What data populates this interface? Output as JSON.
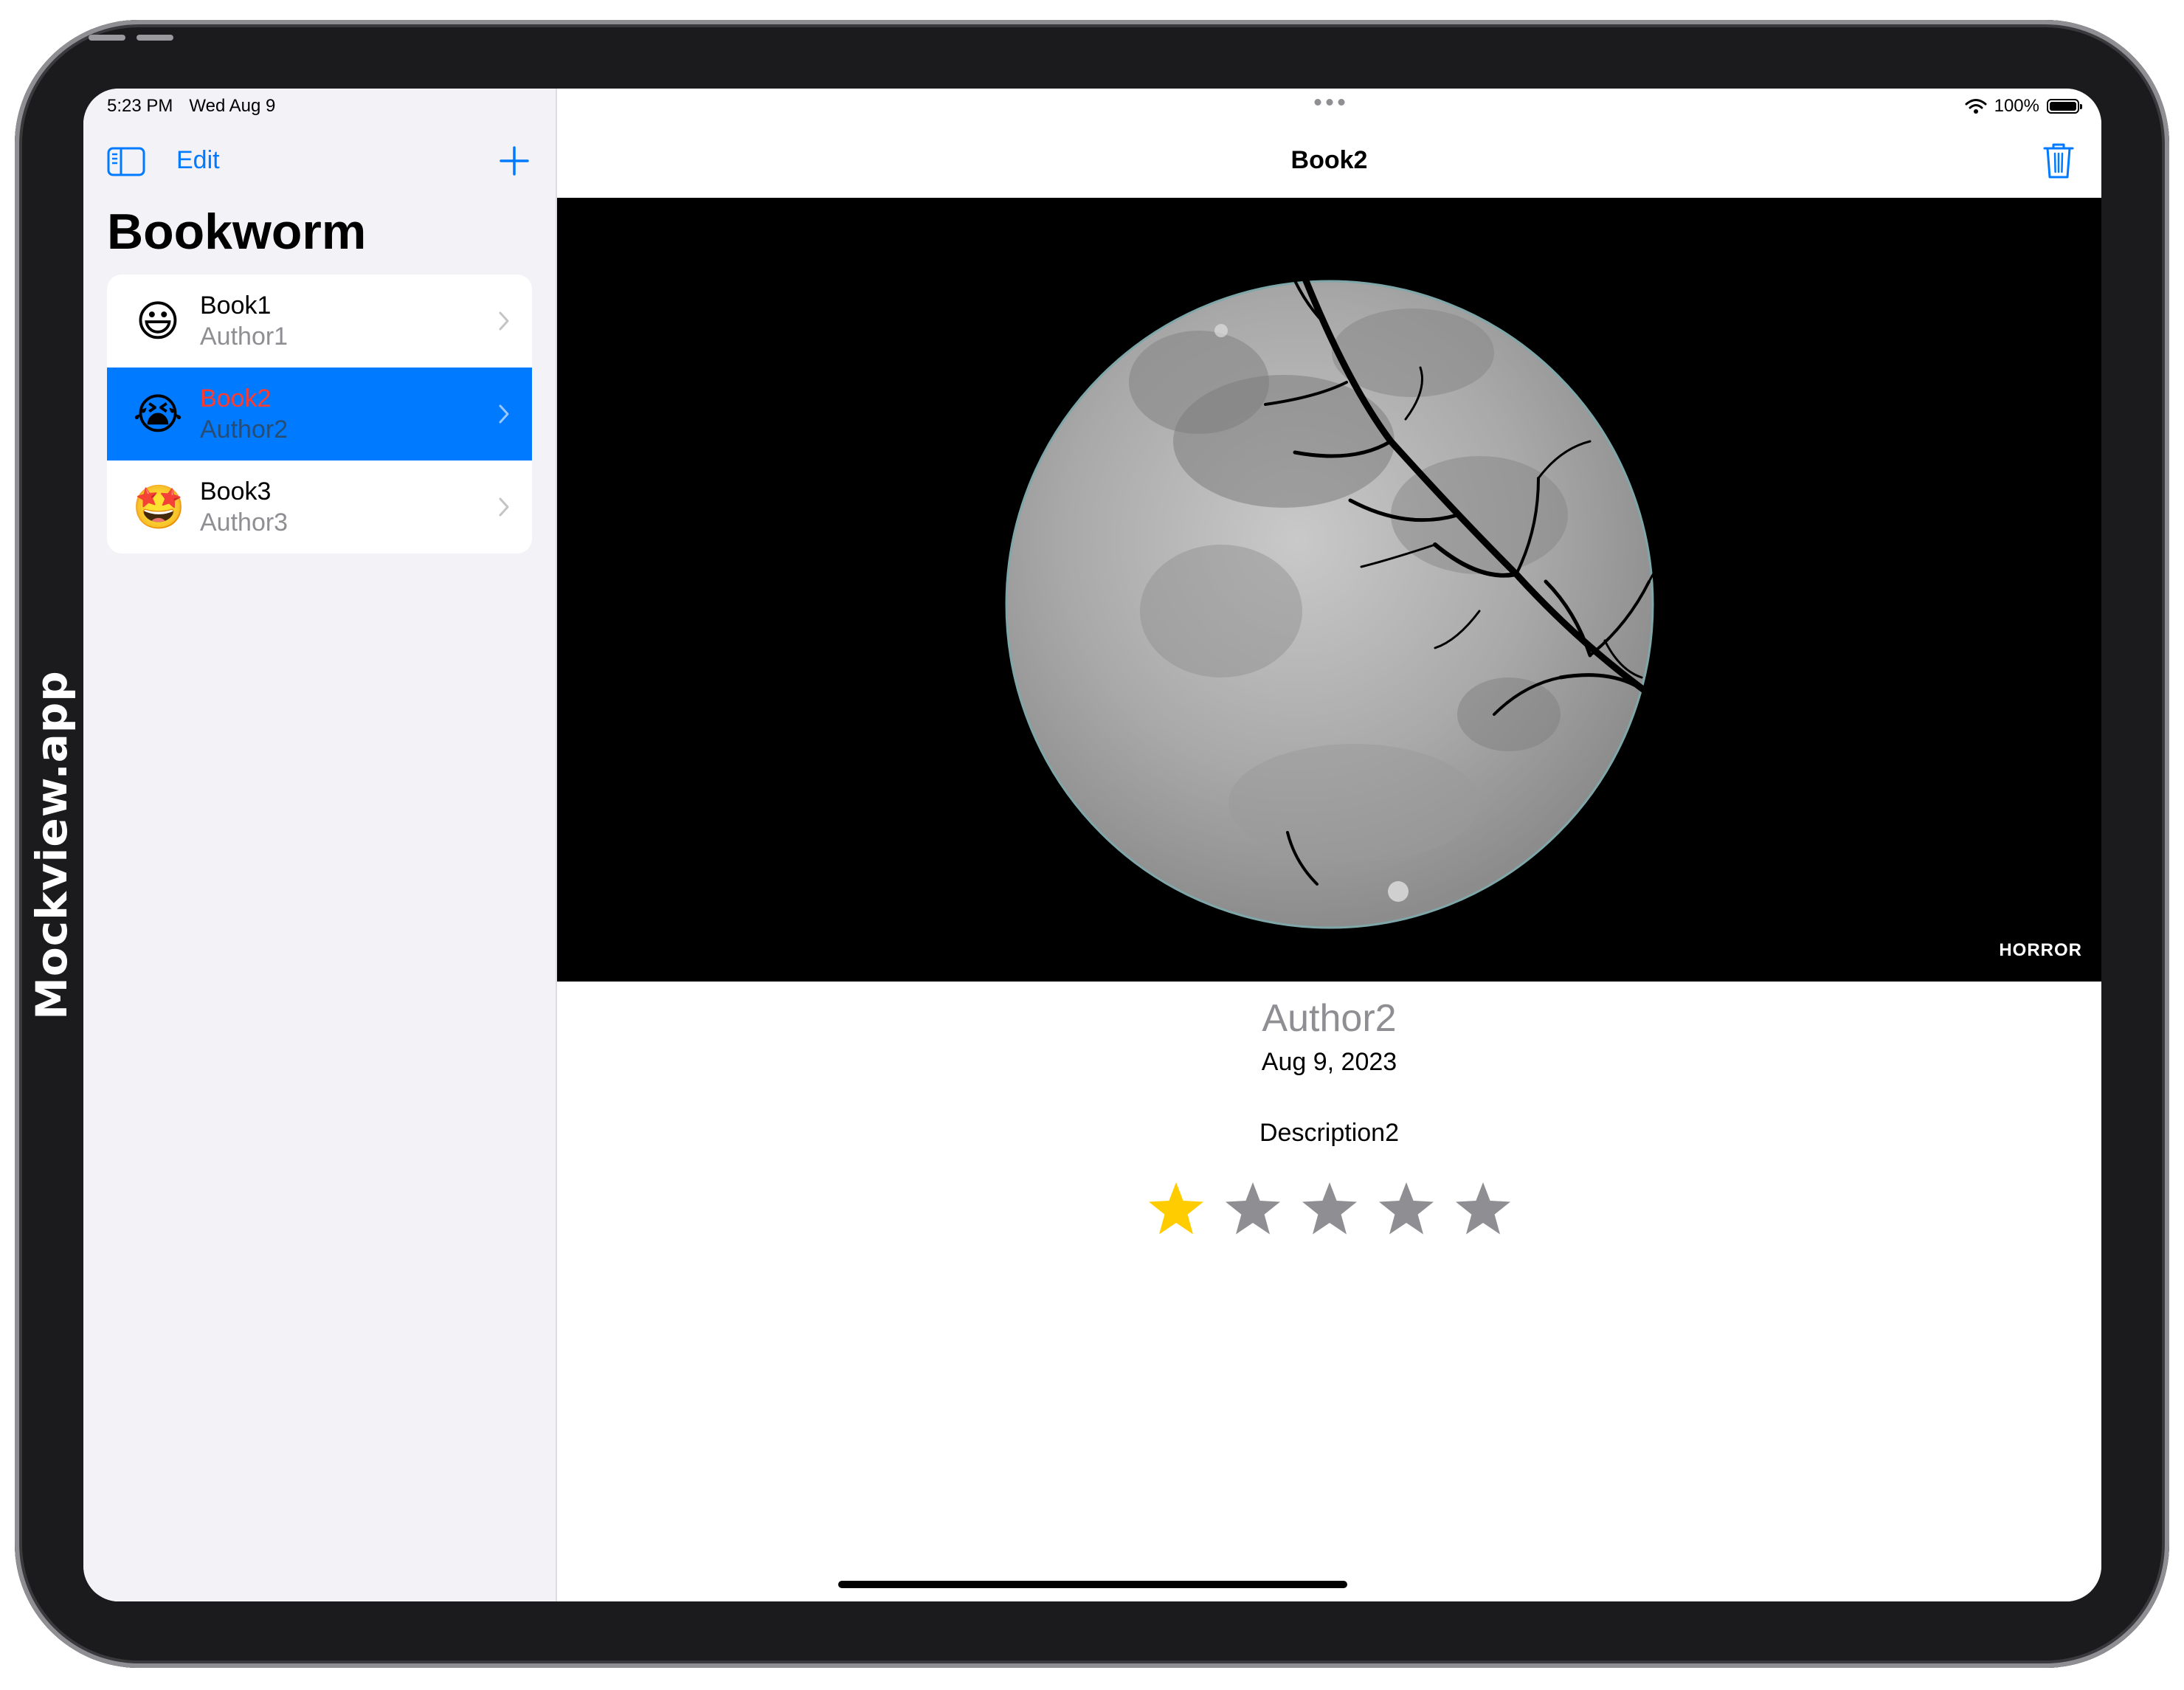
{
  "watermark": "Mockview.app",
  "status_bar": {
    "time": "5:23 PM",
    "date": "Wed Aug 9",
    "battery": "100%",
    "battery_level": 1.0
  },
  "sidebar": {
    "edit_label": "Edit",
    "title": "Bookworm",
    "books": [
      {
        "emoji": "😃",
        "title": "Book1",
        "author": "Author1",
        "selected": false
      },
      {
        "emoji": "😭",
        "title": "Book2",
        "author": "Author2",
        "selected": true
      },
      {
        "emoji": "🤩",
        "title": "Book3",
        "author": "Author3",
        "selected": false
      }
    ]
  },
  "detail": {
    "nav_title": "Book2",
    "genre": "HORROR",
    "author": "Author2",
    "date": "Aug 9, 2023",
    "description": "Description2",
    "rating": 1,
    "max_rating": 5
  },
  "colors": {
    "accent": "#007aff",
    "selected_title": "#ff3b30",
    "star_on": "#ffcc00",
    "star_off": "#8e8e93",
    "secondary_text": "#8e8e93"
  }
}
